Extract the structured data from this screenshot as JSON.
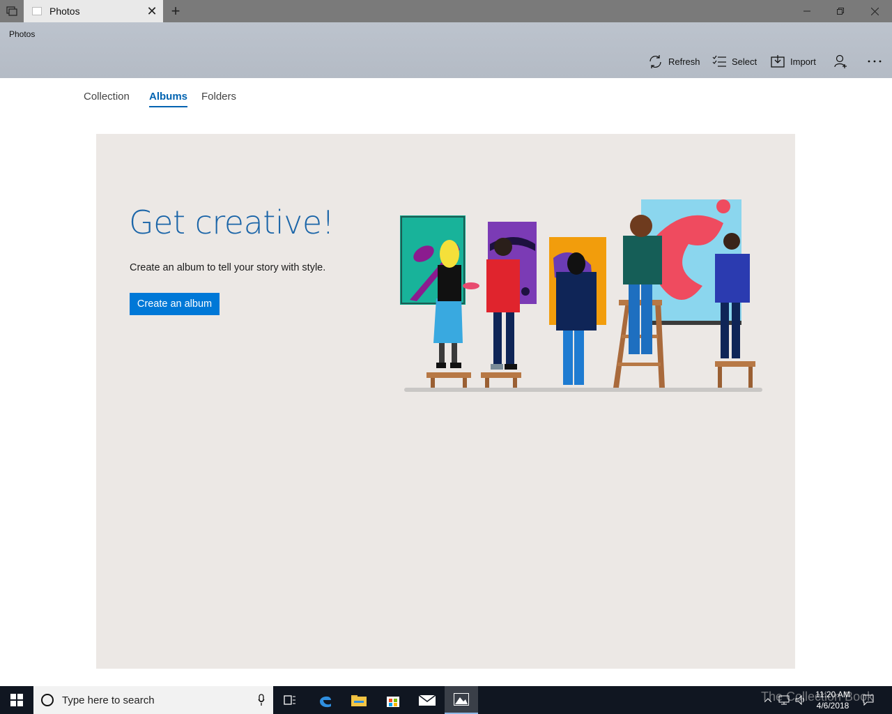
{
  "window": {
    "tab_title": "Photos",
    "app_title": "Photos"
  },
  "toolbar": {
    "refresh_label": "Refresh",
    "select_label": "Select",
    "import_label": "Import"
  },
  "nav": {
    "tabs": [
      {
        "label": "Collection",
        "active": false
      },
      {
        "label": "Albums",
        "active": true
      },
      {
        "label": "Folders",
        "active": false
      }
    ]
  },
  "hero": {
    "title": "Get creative!",
    "subtitle": "Create an album to tell your story with style.",
    "button_label": "Create an album"
  },
  "taskbar": {
    "search_placeholder": "Type here to search",
    "time": "11:20 AM",
    "date": "4/6/2018",
    "watermark": "The Collection Book"
  },
  "colors": {
    "accent": "#0078d7",
    "title_blue": "#1b65a8",
    "header_bg": "#b9c0ca",
    "hero_bg": "#ece8e5",
    "taskbar_bg": "#101621"
  }
}
